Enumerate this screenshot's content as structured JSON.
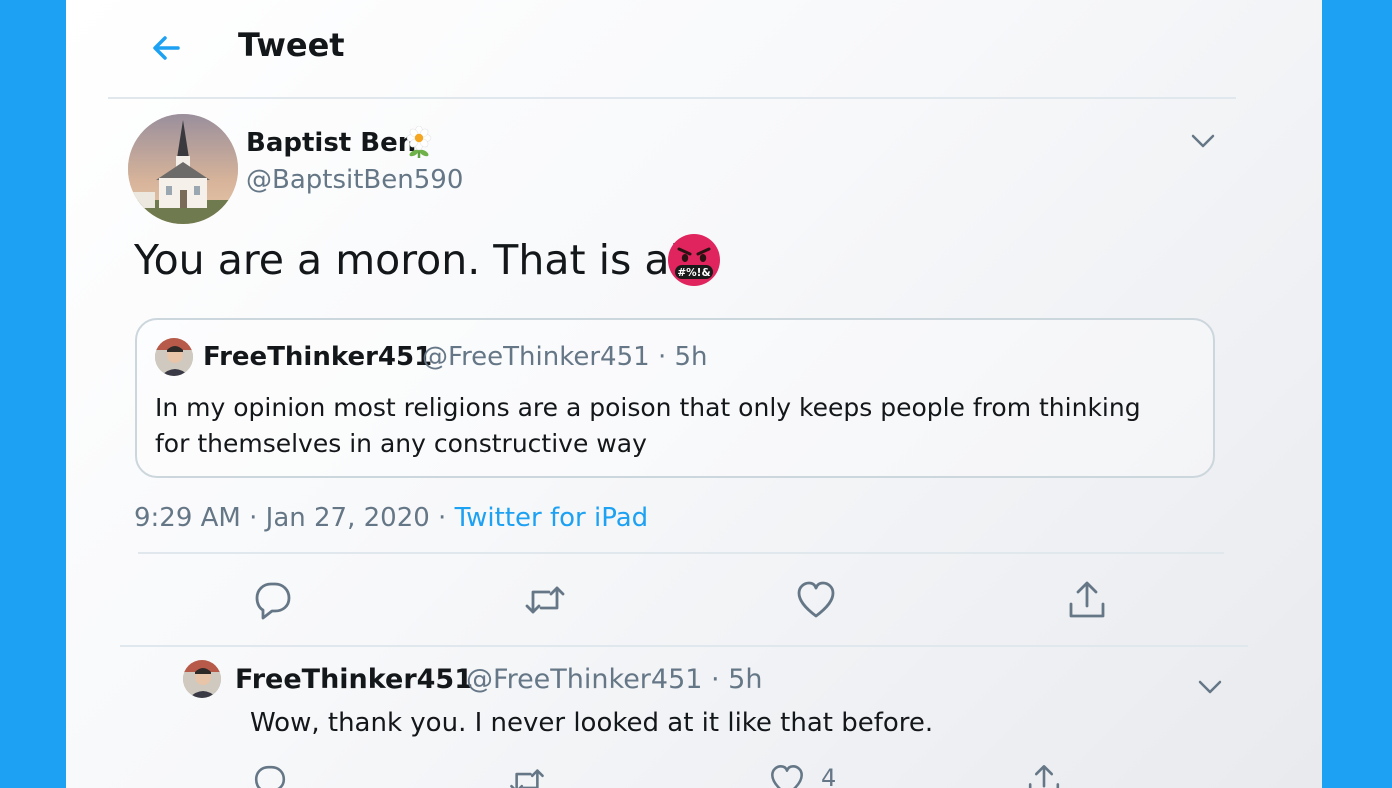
{
  "header": {
    "title": "Tweet",
    "back_icon": "arrow-left-icon"
  },
  "tweet": {
    "author": {
      "display_name": "Baptist Ben",
      "name_emoji": "flower-icon",
      "handle": "@BaptsitBen590"
    },
    "text": "You are a moron. That is all.",
    "emoji": "angry-face-with-symbols-icon",
    "emoji_symbols": "#%!&",
    "timestamp": "9:29 AM · Jan 27, 2020 · ",
    "source": "Twitter for iPad"
  },
  "quoted_tweet": {
    "display_name": "FreeThinker451",
    "meta": "@FreeThinker451 · 5h",
    "text": "In my opinion most religions are a poison that only keeps people from thinking for themselves in any constructive way"
  },
  "actions": [
    "reply-icon",
    "retweet-icon",
    "like-icon",
    "share-icon"
  ],
  "reply": {
    "display_name": "FreeThinker451",
    "meta": "@FreeThinker451 · 5h",
    "text": "Wow, thank you. I never looked at it like that before.",
    "like_count": "4"
  },
  "colors": {
    "accent": "#1da1f2",
    "background": "#1da1f2",
    "angry_red": "#e0245e"
  }
}
